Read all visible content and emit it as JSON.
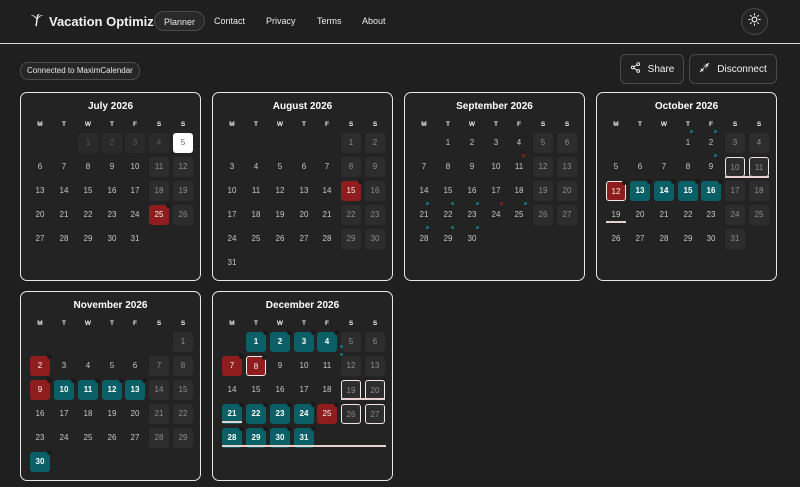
{
  "brand": {
    "name": "Vacation Optimizer",
    "icon": "palm-tree-icon"
  },
  "nav": [
    {
      "label": "Planner",
      "active": true
    },
    {
      "label": "Contact",
      "active": false
    },
    {
      "label": "Privacy",
      "active": false
    },
    {
      "label": "Terms",
      "active": false
    },
    {
      "label": "About",
      "active": false
    }
  ],
  "theme_toggle_icon": "sun-icon",
  "status": {
    "connected": "Connected to MaximCalendar"
  },
  "actions": {
    "share": {
      "label": "Share",
      "icon": "share-icon"
    },
    "disconnect": {
      "label": "Disconnect",
      "icon": "unplug-icon"
    }
  },
  "weekday_headers": [
    "M",
    "T",
    "W",
    "T",
    "F",
    "S",
    "S"
  ],
  "colors": {
    "vacation": "#0b5f66",
    "holiday": "#8f1d1d",
    "today": "#ffffff",
    "marker_teal": "#14787c",
    "marker_red": "#8f1d1d"
  },
  "months": [
    {
      "title": "July 2026",
      "year": 2026,
      "month": 7
    },
    {
      "title": "August 2026",
      "year": 2026,
      "month": 8
    },
    {
      "title": "September 2026",
      "year": 2026,
      "month": 9
    },
    {
      "title": "October 2026",
      "year": 2026,
      "month": 10
    },
    {
      "title": "November 2026",
      "year": 2026,
      "month": 11
    },
    {
      "title": "December 2026",
      "year": 2026,
      "month": 12
    }
  ],
  "days": {
    "July 2026": {
      "today": [
        5
      ],
      "past": [
        1,
        2,
        3,
        4
      ],
      "holiday": [
        25
      ]
    },
    "August 2026": {
      "holiday": [
        15
      ]
    },
    "September 2026": {},
    "October 2026": {
      "holiday": [
        12
      ],
      "vacation": [
        13,
        14,
        15,
        16
      ],
      "boxed": [
        10,
        11,
        12
      ]
    },
    "November 2026": {
      "holiday": [
        2,
        9
      ],
      "vacation": [
        10,
        11,
        12,
        13,
        30
      ]
    },
    "December 2026": {
      "holiday": [
        7,
        8,
        25
      ],
      "vacation": [
        1,
        2,
        3,
        4,
        21,
        22,
        23,
        24,
        28,
        29,
        30,
        31
      ],
      "boxed": [
        8,
        19,
        20,
        26,
        27
      ]
    }
  }
}
